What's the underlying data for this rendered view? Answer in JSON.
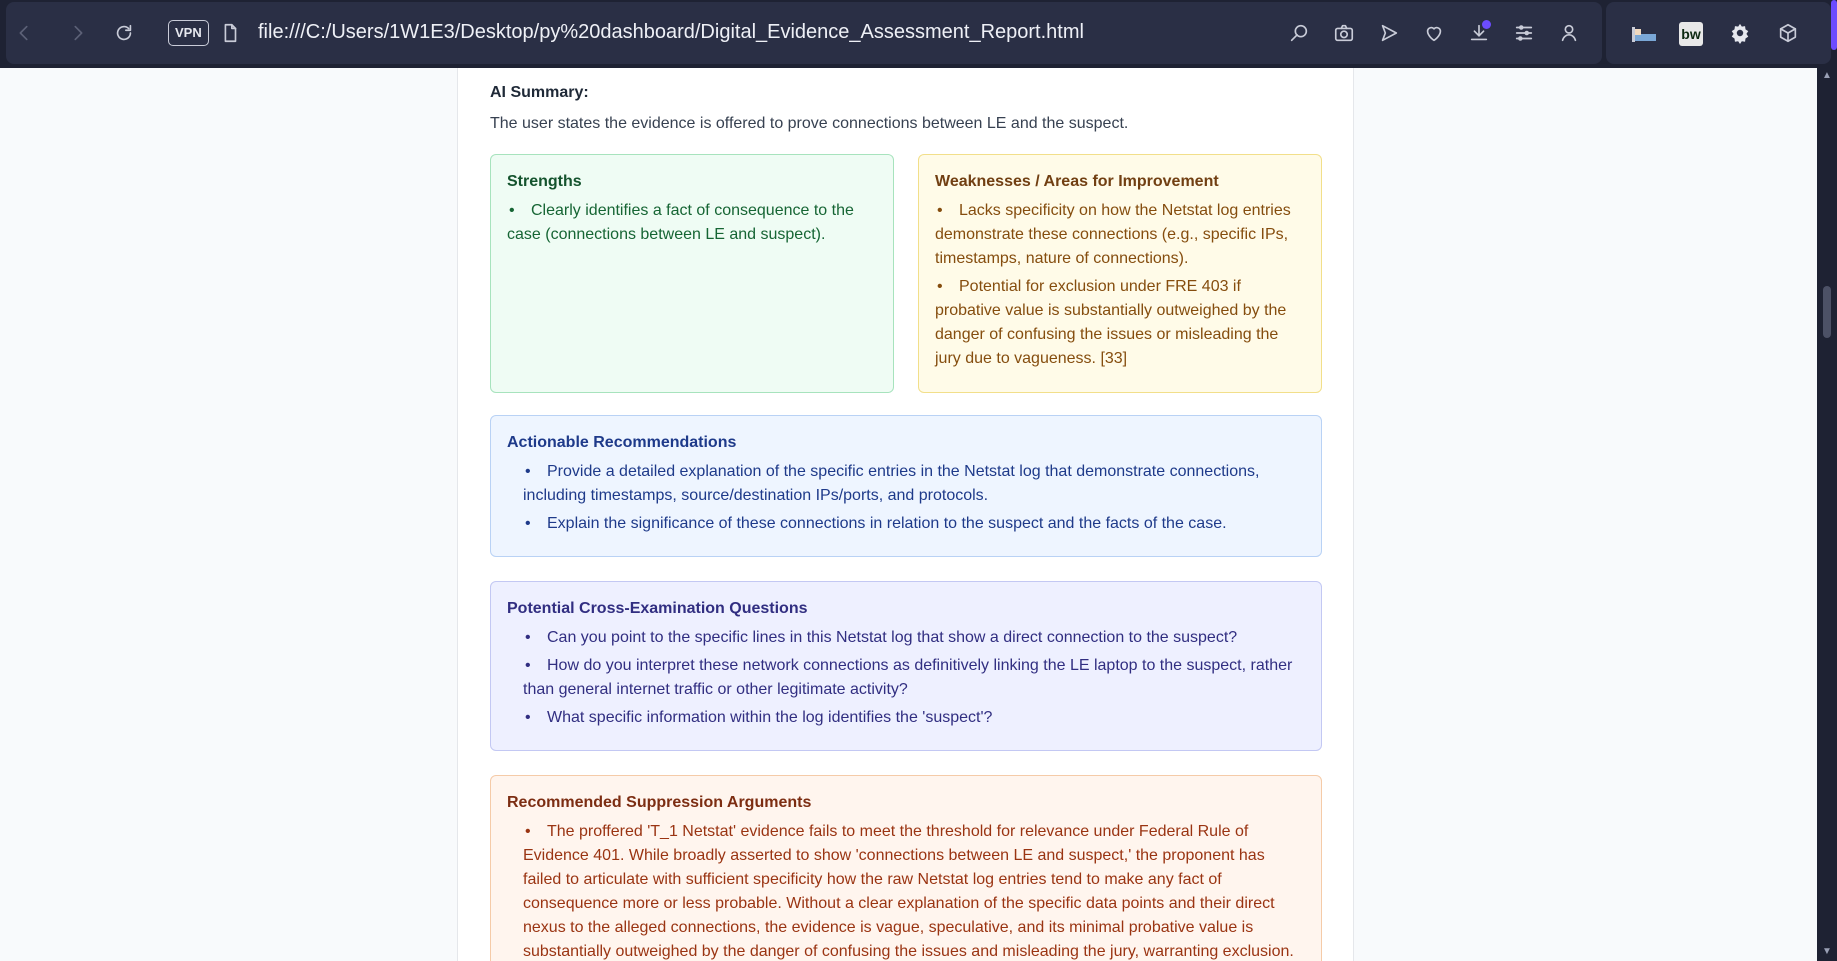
{
  "browser": {
    "vpn_label": "VPN",
    "url": "file:///C:/Users/1W1E3/Desktop/py%20dashboard/Digital_Evidence_Assessment_Report.html",
    "extension_bw_label": "bw"
  },
  "report": {
    "ai_summary_label": "AI Summary:",
    "ai_summary_text": "The user states the evidence is offered to prove connections between LE and the suspect.",
    "strengths": {
      "title": "Strengths",
      "items": [
        "Clearly identifies a fact of consequence to the case (connections between LE and suspect)."
      ]
    },
    "weaknesses": {
      "title": "Weaknesses / Areas for Improvement",
      "items": [
        "Lacks specificity on how the Netstat log entries demonstrate these connections (e.g., specific IPs, timestamps, nature of connections).",
        "Potential for exclusion under FRE 403 if probative value is substantially outweighed by the danger of confusing the issues or misleading the jury due to vagueness. [33]"
      ]
    },
    "recommendations": {
      "title": "Actionable Recommendations",
      "items": [
        "Provide a detailed explanation of the specific entries in the Netstat log that demonstrate connections, including timestamps, source/destination IPs/ports, and protocols.",
        "Explain the significance of these connections in relation to the suspect and the facts of the case."
      ]
    },
    "cross_exam": {
      "title": "Potential Cross-Examination Questions",
      "items": [
        "Can you point to the specific lines in this Netstat log that show a direct connection to the suspect?",
        "How do you interpret these network connections as definitively linking the LE laptop to the suspect, rather than general internet traffic or other legitimate activity?",
        "What specific information within the log identifies the 'suspect'?"
      ]
    },
    "suppression": {
      "title": "Recommended Suppression Arguments",
      "items": [
        "The proffered 'T_1 Netstat' evidence fails to meet the threshold for relevance under Federal Rule of Evidence 401. While broadly asserted to show 'connections between LE and suspect,' the proponent has failed to articulate with sufficient specificity how the raw Netstat log entries tend to make any fact of consequence more or less probable. Without a clear explanation of the specific data points and their direct nexus to the alleged connections, the evidence is vague, speculative, and its minimal probative value is substantially outweighed by the danger of confusing the issues and misleading the jury, warranting exclusion."
      ]
    }
  }
}
